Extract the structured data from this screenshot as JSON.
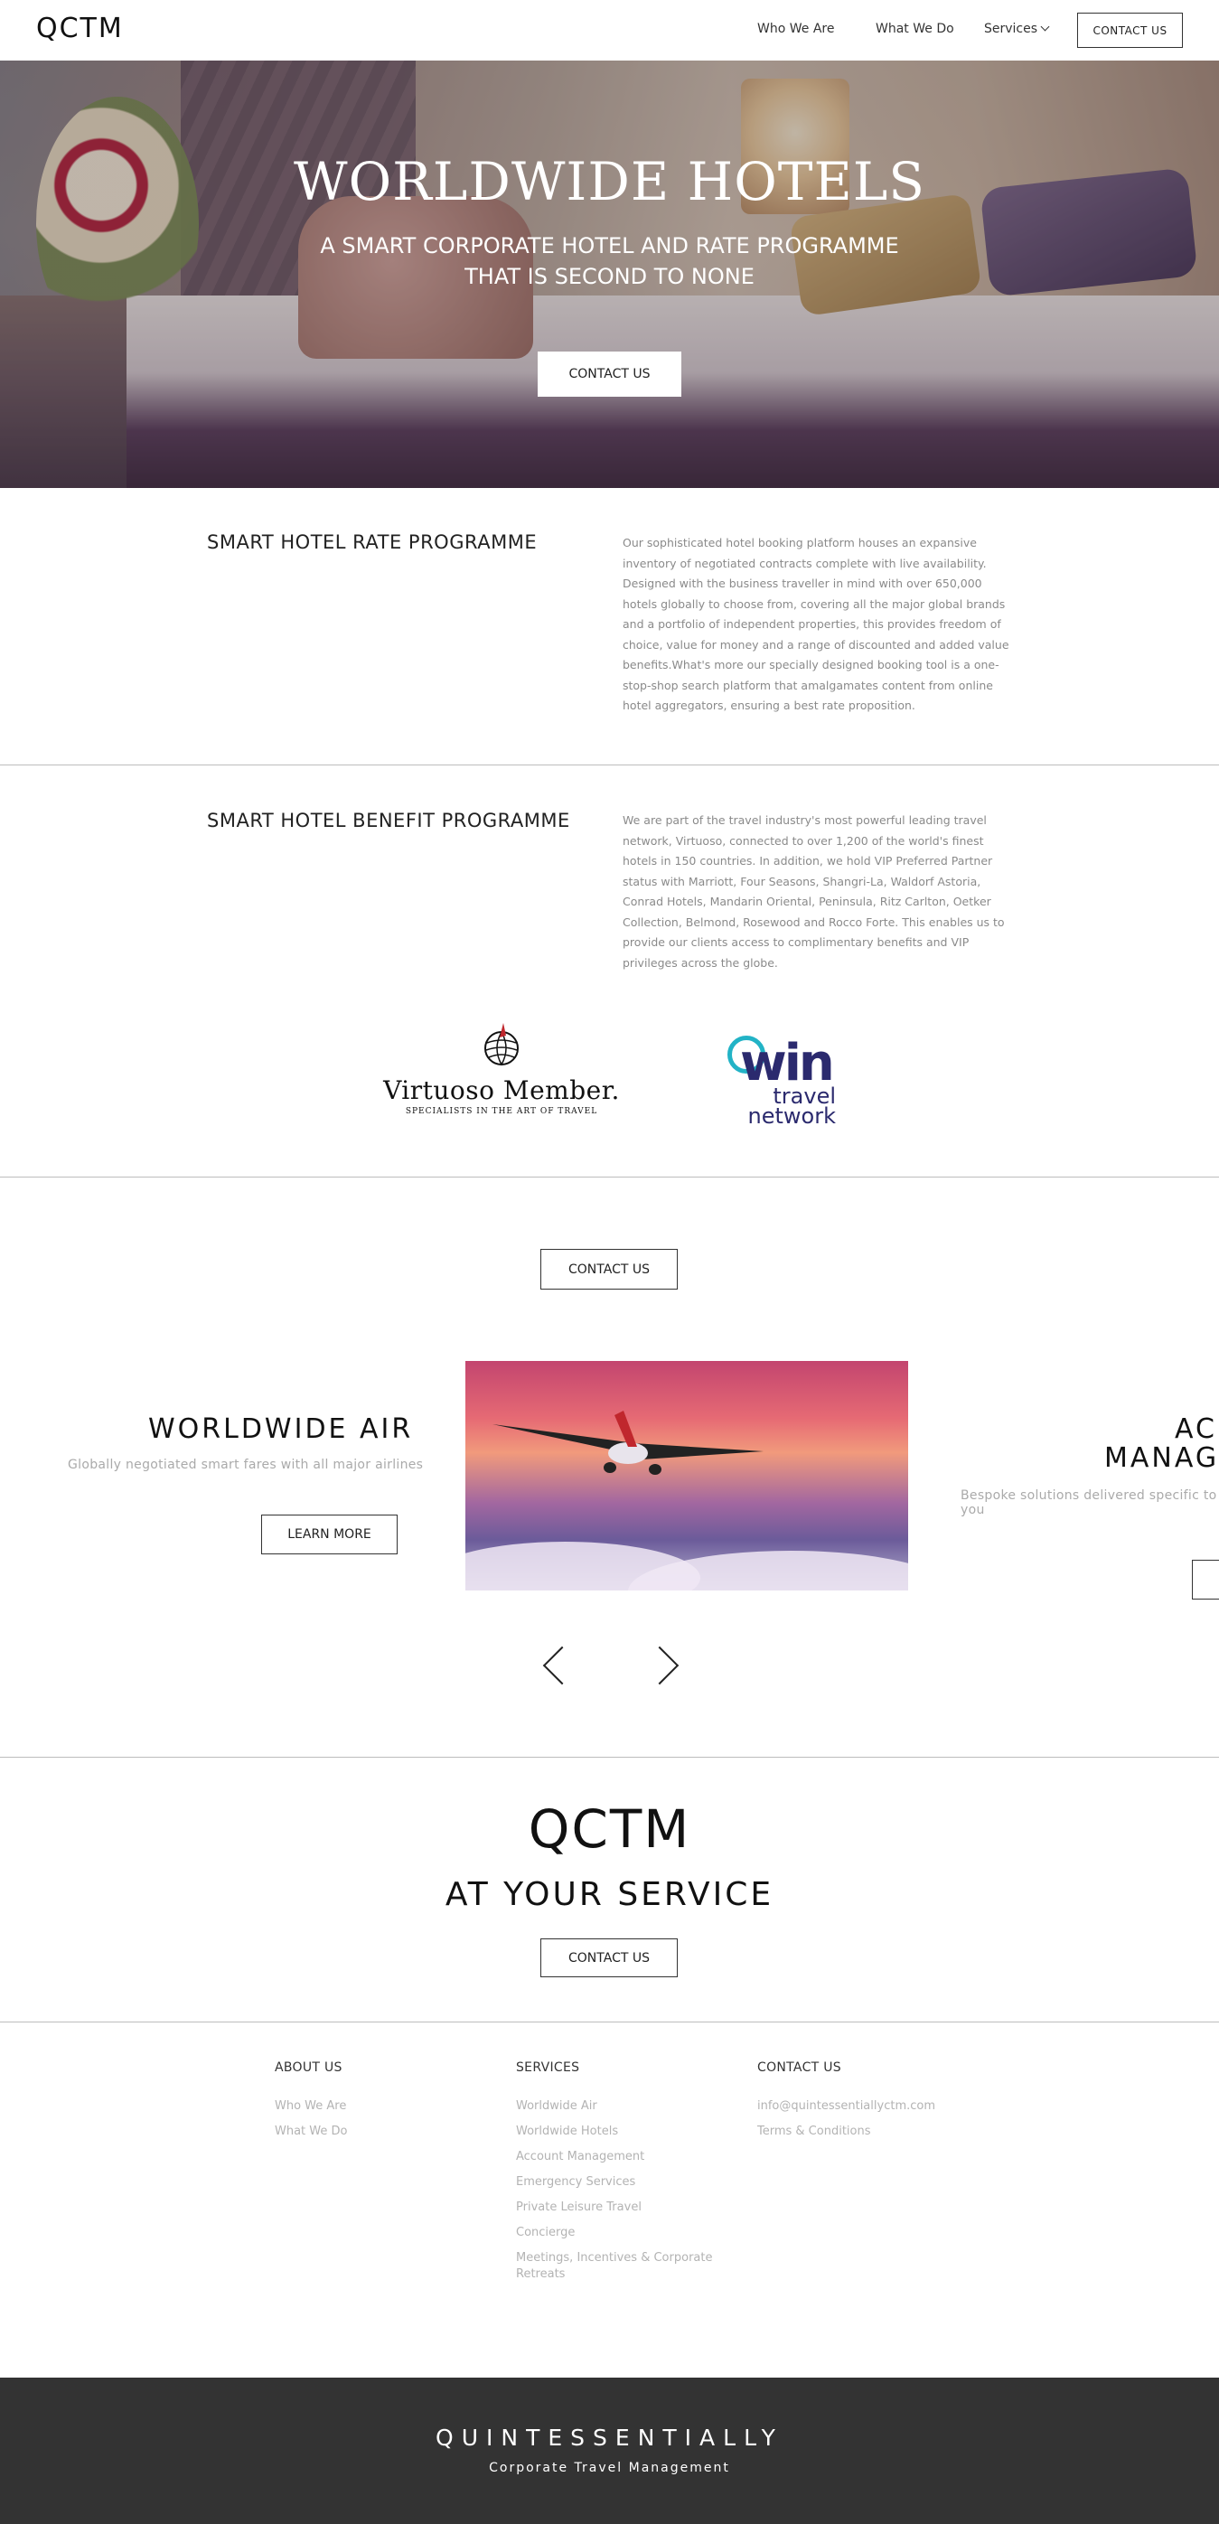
{
  "nav": {
    "logo": "QCTM",
    "who_we_are": "Who We Are",
    "what_we_do": "What We Do",
    "services": "Services",
    "contact": "CONTACT US"
  },
  "hero": {
    "title": "WORLDWIDE HOTELS",
    "subtitle_line1": "A SMART CORPORATE HOTEL AND RATE PROGRAMME",
    "subtitle_line2": "THAT IS SECOND TO NONE",
    "button": "CONTACT US"
  },
  "rate_section": {
    "title": "SMART HOTEL RATE PROGRAMME",
    "body": "Our sophisticated hotel booking platform houses an expansive inventory of negotiated contracts complete with live availability. Designed with the business traveller in mind with over 650,000 hotels globally to choose from, covering all the major global brands and a portfolio of independent properties, this provides freedom of choice, value for money and a range of discounted and added value benefits.What's more our specially designed booking tool is a one-stop-shop search platform that amalgamates content from online hotel aggregators, ensuring a best rate proposition."
  },
  "benefit_section": {
    "title": "SMART HOTEL BENEFIT PROGRAMME",
    "body": "We are part of the travel industry's most powerful leading travel network, Virtuoso, connected to over 1,200 of the world's finest hotels in 150 countries. In addition, we hold VIP Preferred Partner status with Marriott, Four Seasons, Shangri-La, Waldorf Astoria, Conrad Hotels, Mandarin Oriental, Peninsula, Ritz Carlton, Oetker Collection, Belmond, Rosewood and Rocco Forte. This enables us to provide our clients access to complimentary benefits and VIP privileges across the globe."
  },
  "logos": {
    "virtuoso_main": "Virtuoso Member.",
    "virtuoso_sub": "SPECIALISTS IN THE ART OF TRAVEL",
    "win_main": "win",
    "win_sub1": "travel",
    "win_sub2": "network"
  },
  "mid_contact": "CONTACT US",
  "carousel": {
    "left_title": "WORLDWIDE AIR",
    "left_desc": "Globally negotiated smart fares with all major airlines",
    "left_button": "LEARN MORE",
    "right_title1": "AC",
    "right_title2": "MANAG",
    "right_desc": "Bespoke solutions delivered specific to you",
    "prev_icon": "chevron-left-icon",
    "next_icon": "chevron-right-icon"
  },
  "service_block": {
    "logo": "QCTM",
    "tagline": "AT YOUR SERVICE",
    "button": "CONTACT US"
  },
  "footer": {
    "about": {
      "heading": "ABOUT US",
      "links": [
        "Who We Are",
        "What We Do"
      ]
    },
    "services": {
      "heading": "SERVICES",
      "links": [
        "Worldwide Air",
        "Worldwide Hotels",
        "Account Management",
        "Emergency Services",
        "Private Leisure Travel",
        "Concierge",
        "Meetings, Incentives & Corporate Retreats"
      ]
    },
    "contact": {
      "heading": "CONTACT US",
      "links": [
        "info@quintessentiallyctm.com",
        "Terms & Conditions"
      ]
    }
  },
  "bottom_bar": {
    "title": "QUINTESSENTIALLY",
    "subtitle": "Corporate Travel Management"
  }
}
